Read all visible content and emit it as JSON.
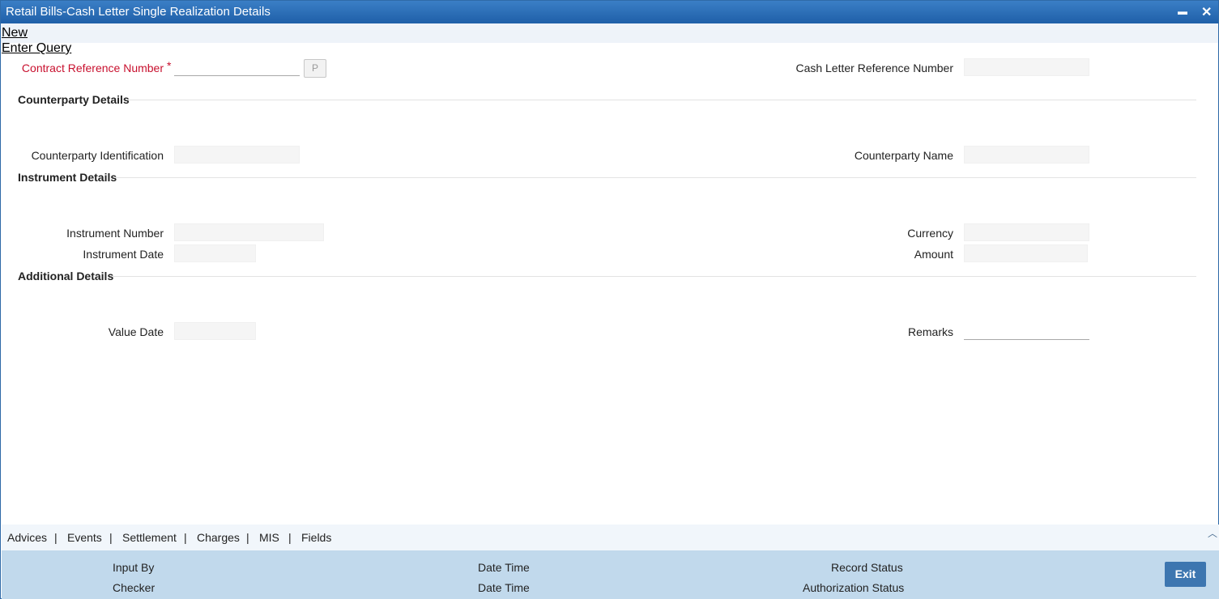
{
  "window": {
    "title": "Retail Bills-Cash Letter Single Realization Details",
    "minimize_glyph": "▬",
    "close_glyph": "✕"
  },
  "toolbar": {
    "new_label": "New",
    "enter_query_label": "Enter Query"
  },
  "header": {
    "contract_ref_label": "Contract Reference Number",
    "required_mark": "*",
    "p_button": "P",
    "cash_letter_ref_label": "Cash Letter Reference Number"
  },
  "counterparty": {
    "section": "Counterparty Details",
    "id_label": "Counterparty Identification",
    "name_label": "Counterparty Name"
  },
  "instrument": {
    "section": "Instrument Details",
    "number_label": "Instrument Number",
    "date_label": "Instrument Date",
    "currency_label": "Currency",
    "amount_label": "Amount"
  },
  "additional": {
    "section": "Additional Details",
    "value_date_label": "Value Date",
    "remarks_label": "Remarks"
  },
  "tabs": {
    "advices": "Advices",
    "events": "Events",
    "settlement": "Settlement",
    "charges": "Charges",
    "mis": "MIS",
    "fields": "Fields",
    "separator": "|",
    "scroll_up_glyph": "︿"
  },
  "footer": {
    "input_by": "Input By",
    "date_time_1": "Date Time",
    "record_status": "Record Status",
    "checker": "Checker",
    "date_time_2": "Date Time",
    "authorization_status": "Authorization Status",
    "exit_label": "Exit"
  }
}
